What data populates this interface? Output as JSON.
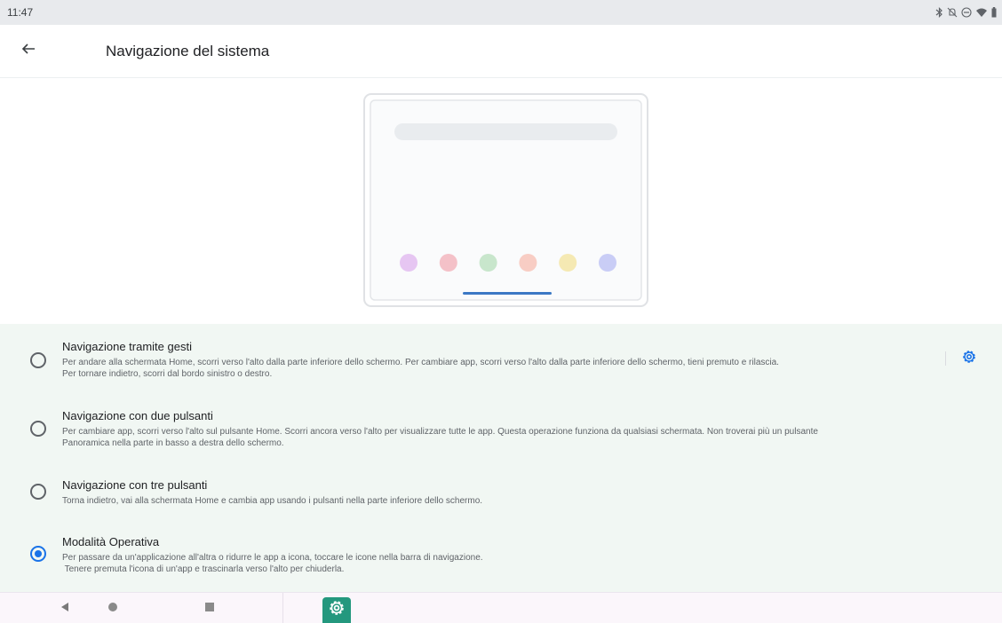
{
  "status_bar": {
    "time": "11:47",
    "icons": [
      "bluetooth-icon",
      "mute-icon",
      "do-not-disturb-icon",
      "wifi-icon",
      "battery-icon"
    ]
  },
  "app_bar": {
    "back_icon": "arrow-back-icon",
    "title": "Navigazione del sistema"
  },
  "illustration": {
    "dot_colors": [
      "#e6c6f2",
      "#f4c1c8",
      "#c8e6cc",
      "#f8cdc4",
      "#f5e9b3",
      "#c9cdf6"
    ],
    "handle_color": "#3b78c5"
  },
  "options": [
    {
      "title": "Navigazione tramite gesti",
      "desc_lines": [
        "Per andare alla schermata Home, scorri verso l'alto dalla parte inferiore dello schermo. Per cambiare app, scorri verso l'alto dalla parte inferiore dello schermo, tieni premuto e rilascia.",
        "Per tornare indietro, scorri dal bordo sinistro o destro."
      ],
      "selected": false,
      "has_settings": true
    },
    {
      "title": "Navigazione con due pulsanti",
      "desc_lines": [
        "Per cambiare app, scorri verso l'alto sul pulsante Home. Scorri ancora verso l'alto per visualizzare tutte le app. Questa operazione funziona da qualsiasi schermata. Non troverai più un pulsante",
        "Panoramica nella parte in basso a destra dello schermo."
      ],
      "selected": false,
      "has_settings": false
    },
    {
      "title": "Navigazione con tre pulsanti",
      "desc_lines": [
        "Torna indietro, vai alla schermata Home e cambia app usando i pulsanti nella parte inferiore dello schermo."
      ],
      "selected": false,
      "has_settings": false
    },
    {
      "title": "Modalità Operativa",
      "desc_lines": [
        "Per passare da un'applicazione all'altra o ridurre le app a icona, toccare le icone nella barra di navigazione.",
        " Tenere premuta l'icona di un'app e trascinarla verso l'alto per chiuderla."
      ],
      "selected": true,
      "has_settings": false
    }
  ],
  "colors": {
    "accent": "#1a73e8",
    "settings_app": "#24987e",
    "options_bg": "#f1f7f3"
  },
  "nav_bar": {
    "buttons": [
      "back-triangle-icon",
      "home-circle-icon",
      "recents-square-icon"
    ],
    "pinned_app": "settings-gear-icon"
  }
}
